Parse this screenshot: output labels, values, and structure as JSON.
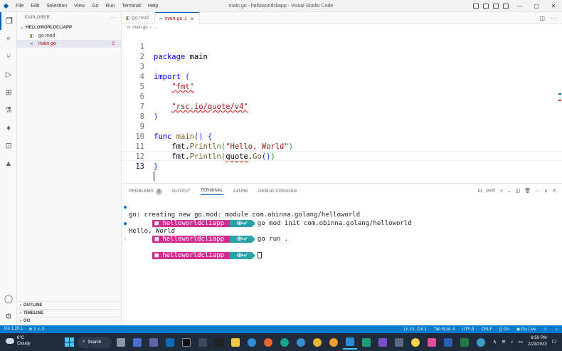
{
  "titlebar": {
    "menu": [
      "File",
      "Edit",
      "Selection",
      "View",
      "Go",
      "Run",
      "Terminal",
      "Help"
    ],
    "window_title": "main.go - helloworldcliapp - Visual Studio Code"
  },
  "sidebar": {
    "header": "EXPLORER",
    "more": "···",
    "folder": "HELLOWORLDCLIAPP",
    "files": [
      {
        "name": "go.mod",
        "badge": ""
      },
      {
        "name": "main.go",
        "badge": "2"
      }
    ],
    "sections": [
      "OUTLINE",
      "TIMELINE",
      "GO"
    ]
  },
  "tabs": [
    {
      "label": "go.mod",
      "badge": "",
      "active": false
    },
    {
      "label": "main.go",
      "badge": "2",
      "active": true
    }
  ],
  "breadcrumb": {
    "file": "main.go",
    "rest": "..."
  },
  "editor": {
    "line_numbers": [
      "1",
      "2",
      "3",
      "4",
      "5",
      "6",
      "7",
      "8",
      "9",
      "10",
      "11",
      "12",
      "13"
    ],
    "current_line": "13",
    "code": {
      "l1_kw": "package",
      "l1_name": "main",
      "l3_kw": "import",
      "l3_paren": "(",
      "l4_str": "\"fmt\"",
      "l6_str": "\"rsc.io/quote/v4\"",
      "l7_paren": ")",
      "l9_kw": "func",
      "l9_fn": "main",
      "l9_rest": "() {",
      "l10_pkg": "fmt",
      "l10_fn": "Println",
      "l10_str": "\"Hello, World\"",
      "l11_pkg": "fmt",
      "l11_fn": "Println",
      "l11_pkg2": "quote",
      "l11_fn2": "Go",
      "l11_call": "()",
      "l12_brace": "}"
    }
  },
  "panel": {
    "tabs": [
      {
        "label": "PROBLEMS",
        "badge": "2"
      },
      {
        "label": "OUTPUT",
        "badge": ""
      },
      {
        "label": "TERMINAL",
        "badge": ""
      },
      {
        "label": "AZURE",
        "badge": ""
      },
      {
        "label": "DEBUG CONSOLE",
        "badge": ""
      }
    ],
    "active_tab": "TERMINAL",
    "shell": "push",
    "terminal": {
      "prompt_dir": "helloworldcliapp",
      "prompt_git": "⟴✔",
      "cmd1": "go mod init com.obinna.golang/helloworld",
      "out1": "go: creating new go.mod: module com.obinna.golang/helloworld",
      "cmd2": "go run .",
      "out2": "Hello, World"
    }
  },
  "statusbar": {
    "go_version": "Go 1.20.1",
    "errors": "2",
    "warnings": "0",
    "position": "Ln 13, Col 1",
    "tab_size": "Tab Size: 4",
    "encoding": "UTF-8",
    "eol": "CRLF",
    "language": "Go",
    "live": "Go Live"
  },
  "taskbar": {
    "temperature": "6°C",
    "weather": "Cloudy",
    "search": "Search",
    "time": "8:50 PM",
    "date": "2/23/2023"
  }
}
